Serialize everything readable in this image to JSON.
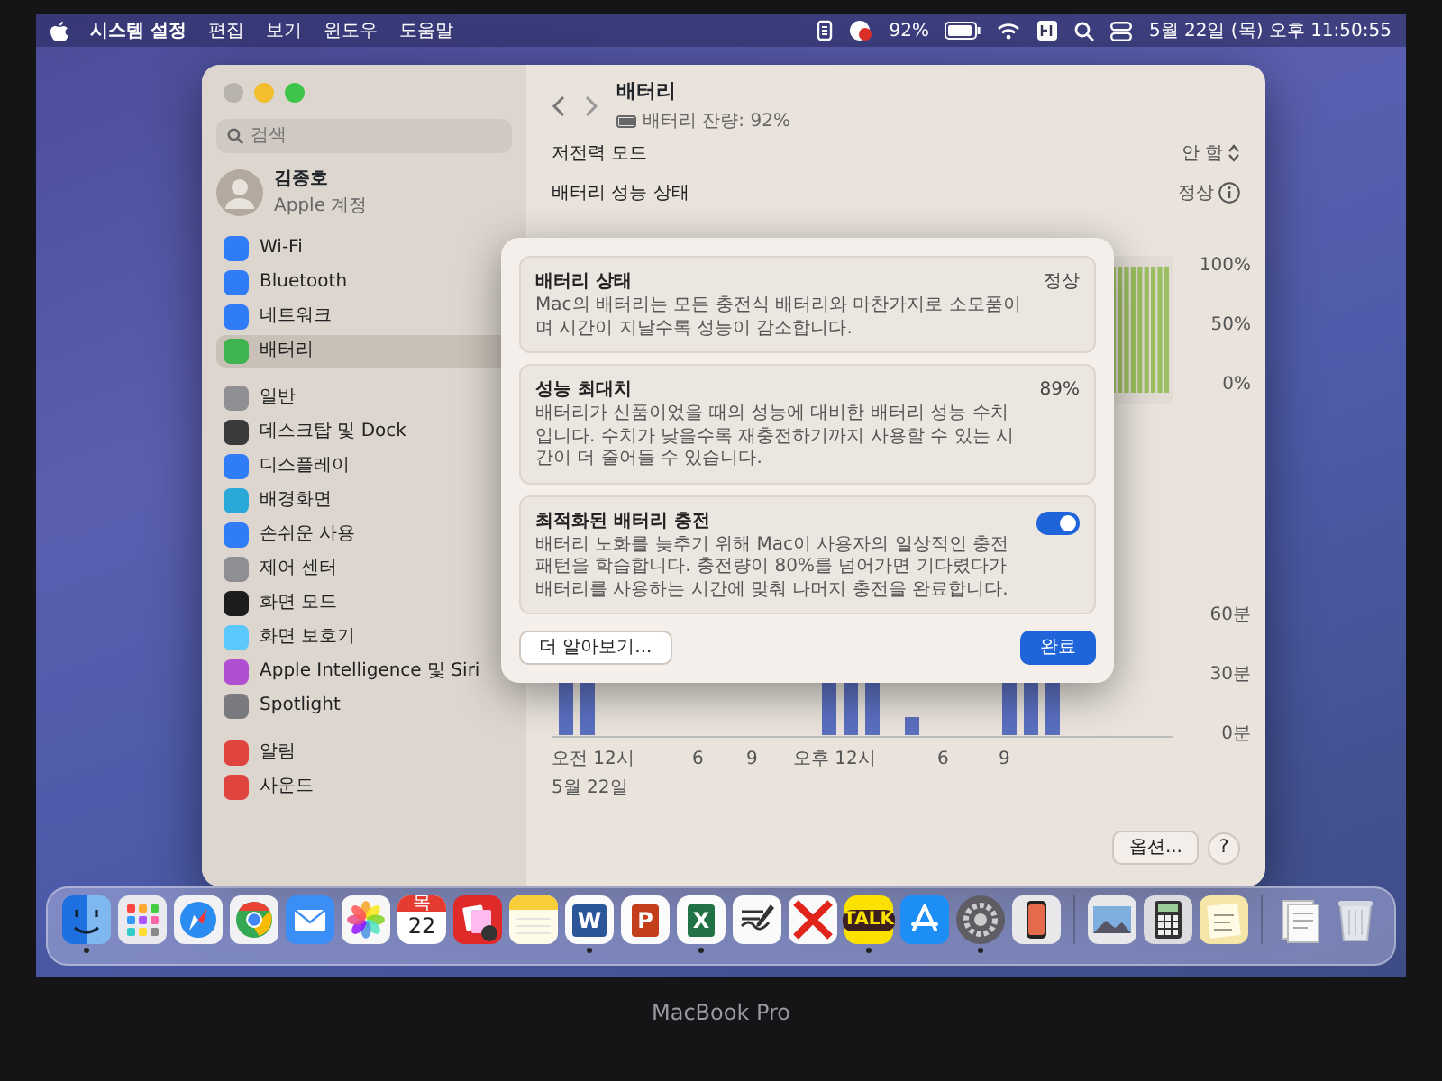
{
  "menu_bar": {
    "app_menus": [
      "시스템 설정",
      "편집",
      "보기",
      "윈도우",
      "도움말"
    ],
    "battery_percent": "92%",
    "clock": "5월 22일 (목) 오후 11:50:55"
  },
  "settings_window": {
    "search": {
      "placeholder": "검색"
    },
    "account": {
      "name": "김종호",
      "subtitle": "Apple 계정"
    },
    "sidebar": {
      "groups": [
        [
          {
            "label": "Wi-Fi",
            "selected": false
          },
          {
            "label": "Bluetooth",
            "selected": false
          },
          {
            "label": "네트워크",
            "selected": false
          },
          {
            "label": "배터리",
            "selected": true
          }
        ],
        [
          {
            "label": "일반",
            "selected": false
          },
          {
            "label": "데스크탑 및 Dock",
            "selected": false
          },
          {
            "label": "디스플레이",
            "selected": false
          },
          {
            "label": "배경화면",
            "selected": false
          },
          {
            "label": "손쉬운 사용",
            "selected": false
          },
          {
            "label": "제어 센터",
            "selected": false
          },
          {
            "label": "화면 모드",
            "selected": false
          },
          {
            "label": "화면 보호기",
            "selected": false
          },
          {
            "label": "Apple Intelligence 및 Siri",
            "selected": false
          },
          {
            "label": "Spotlight",
            "selected": false
          }
        ],
        [
          {
            "label": "알림",
            "selected": false
          },
          {
            "label": "사운드",
            "selected": false
          }
        ]
      ]
    },
    "header": {
      "title": "배터리",
      "subtitle": "배터리 잔량: 92%"
    },
    "rows": [
      {
        "kind": "popup",
        "label": "저전력 모드",
        "value": "안 함"
      },
      {
        "kind": "info",
        "label": "배터리 성능 상태",
        "value": "정상"
      }
    ],
    "charts": {
      "level_labels": [
        "100%",
        "50%",
        "0%"
      ],
      "usage_labels": [
        "60분",
        "30분",
        "0분"
      ],
      "time_labels": [
        "오전 12시",
        "6",
        "9",
        "오후 12시",
        "6",
        "9"
      ],
      "date": "5월 22일"
    },
    "buttons": [
      {
        "kind": "text",
        "label": "옵션..."
      },
      {
        "kind": "help",
        "label": "?"
      }
    ]
  },
  "dialog": {
    "sections": [
      {
        "kind": "status",
        "title": "배터리 상태",
        "value": "정상",
        "description": "Mac의 배터리는 모든 충전식 배터리와 마찬가지로 소모품이며 시간이 지날수록 성능이 감소합니다."
      },
      {
        "kind": "status",
        "title": "성능 최대치",
        "value": "89%",
        "description": "배터리가 신품이었을 때의 성능에 대비한 배터리 성능 수치입니다. 수치가 낮을수록 재충전하기까지 사용할 수 있는 시간이 더 줄어들 수 있습니다."
      },
      {
        "kind": "toggle",
        "title": "최적화된 배터리 충전",
        "on": true,
        "description": "배터리 노화를 늦추기 위해 Mac이 사용자의 일상적인 충전 패턴을 학습합니다. 충전량이 80%를 넘어가면 기다렸다가 배터리를 사용하는 시간에 맞춰 나머지 충전을 완료합니다."
      }
    ],
    "buttons": [
      {
        "label": "더 알아보기...",
        "primary": false
      },
      {
        "label": "완료",
        "primary": true
      }
    ]
  },
  "dock": {
    "items": [
      {
        "kind": "finder",
        "running": true
      },
      {
        "kind": "launchpad",
        "running": false
      },
      {
        "kind": "safari",
        "running": false
      },
      {
        "kind": "chrome",
        "running": false
      },
      {
        "kind": "mail",
        "running": false
      },
      {
        "kind": "photos",
        "running": false
      },
      {
        "kind": "calendar",
        "running": false,
        "header": "목",
        "text": "22"
      },
      {
        "kind": "photobooth",
        "running": false
      },
      {
        "kind": "notes",
        "running": false
      },
      {
        "kind": "letter",
        "running": true,
        "text": "W",
        "color": "#2b579a"
      },
      {
        "kind": "letter",
        "running": false,
        "text": "P",
        "color": "#c43e1c"
      },
      {
        "kind": "letter",
        "running": true,
        "text": "X",
        "color": "#217346"
      },
      {
        "kind": "freeform",
        "running": false
      },
      {
        "kind": "cross",
        "running": false
      },
      {
        "kind": "chat",
        "running": true,
        "text": "TALK"
      },
      {
        "kind": "appstore",
        "running": false
      },
      {
        "kind": "gear",
        "running": true
      },
      {
        "kind": "phone",
        "running": false
      },
      {
        "kind": "separator"
      },
      {
        "kind": "preview",
        "running": false
      },
      {
        "kind": "calculator",
        "running": false
      },
      {
        "kind": "memo",
        "running": false
      },
      {
        "kind": "separator"
      },
      {
        "kind": "stack",
        "running": false
      },
      {
        "kind": "trash",
        "running": false
      }
    ]
  },
  "device_label": "MacBook Pro"
}
